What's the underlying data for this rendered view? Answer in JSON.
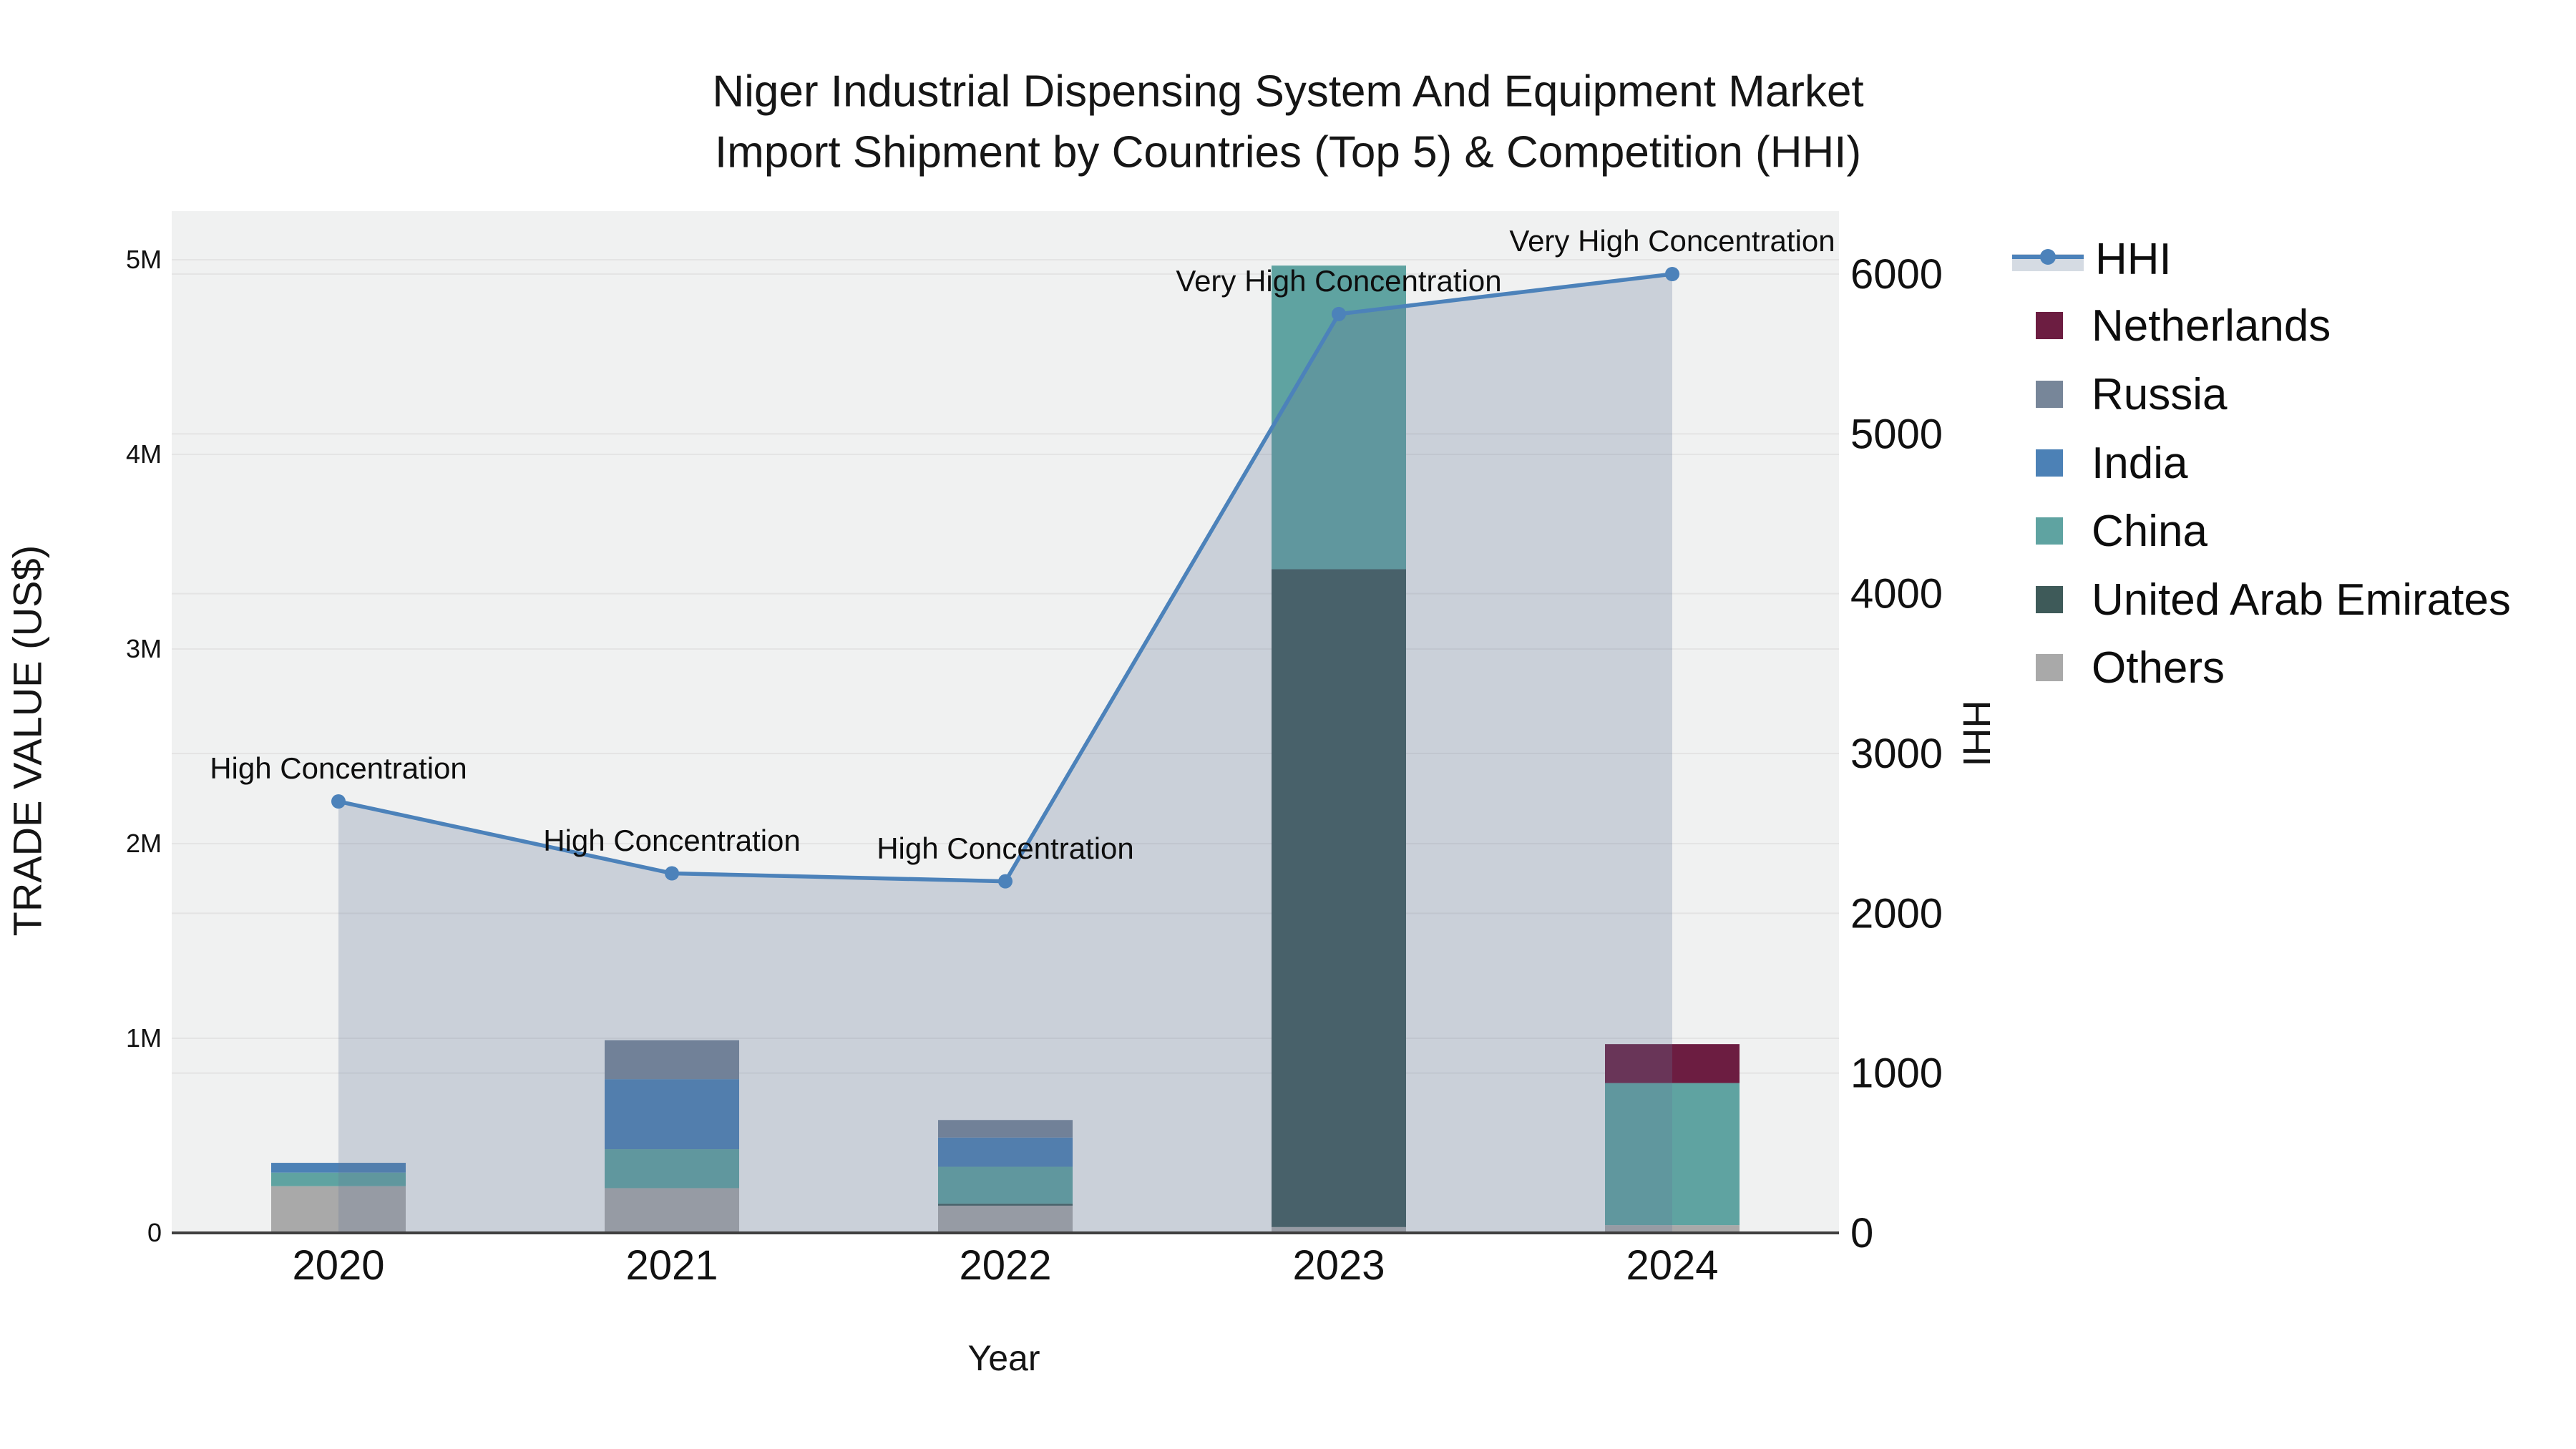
{
  "title": {
    "line1": "Niger Industrial Dispensing System And Equipment Market",
    "line2": "Import Shipment by Countries (Top 5) & Competition (HHI)"
  },
  "axes": {
    "x": {
      "title": "Year",
      "tick_labels": [
        "2020",
        "2021",
        "2022",
        "2023",
        "2024"
      ]
    },
    "y_left": {
      "title": "TRADE VALUE (US$)",
      "tick_labels": [
        "0",
        "1M",
        "2M",
        "3M",
        "4M",
        "5M"
      ],
      "tick_values": [
        0,
        1000000,
        2000000,
        3000000,
        4000000,
        5000000
      ]
    },
    "y_right": {
      "title": "HHI",
      "tick_labels": [
        "0",
        "1000",
        "2000",
        "3000",
        "4000",
        "5000",
        "6000"
      ],
      "tick_values": [
        0,
        1000,
        2000,
        3000,
        4000,
        5000,
        6000
      ]
    }
  },
  "legend": {
    "items": [
      {
        "label": "HHI",
        "type": "line",
        "color": "#4C82BA",
        "band": "#D5DBE3"
      },
      {
        "label": "Netherlands",
        "type": "swatch",
        "color": "#6C1D41"
      },
      {
        "label": "Russia",
        "type": "swatch",
        "color": "#778699"
      },
      {
        "label": "India",
        "type": "swatch",
        "color": "#4C81B6"
      },
      {
        "label": "China",
        "type": "swatch",
        "color": "#5FA3A1"
      },
      {
        "label": "United Arab Emirates",
        "type": "swatch",
        "color": "#3E5A59"
      },
      {
        "label": "Others",
        "type": "swatch",
        "color": "#A9A9A9"
      }
    ]
  },
  "chart_data": {
    "type": "bar+line",
    "categories": [
      "2020",
      "2021",
      "2022",
      "2023",
      "2024"
    ],
    "bar_value_unit": "US$",
    "stack_order_bottom_to_top": [
      "Others",
      "United Arab Emirates",
      "China",
      "India",
      "Russia",
      "Netherlands"
    ],
    "series": [
      {
        "name": "Netherlands",
        "type": "bar",
        "color": "#6C1D41",
        "values": [
          0,
          0,
          0,
          0,
          200000
        ]
      },
      {
        "name": "Russia",
        "type": "bar",
        "color": "#778699",
        "values": [
          0,
          200000,
          90000,
          0,
          0
        ]
      },
      {
        "name": "India",
        "type": "bar",
        "color": "#4C81B6",
        "values": [
          50000,
          360000,
          150000,
          0,
          0
        ]
      },
      {
        "name": "China",
        "type": "bar",
        "color": "#5FA3A1",
        "values": [
          70000,
          200000,
          190000,
          1560000,
          730000
        ]
      },
      {
        "name": "United Arab Emirates",
        "type": "bar",
        "color": "#3E5A59",
        "values": [
          0,
          0,
          10000,
          3380000,
          0
        ]
      },
      {
        "name": "Others",
        "type": "bar",
        "color": "#A9A9A9",
        "values": [
          240000,
          230000,
          140000,
          30000,
          40000
        ]
      }
    ],
    "line_series": {
      "name": "HHI",
      "axis": "right",
      "color": "#4C82BA",
      "area_fill": "rgba(100,120,150,0.27)",
      "values": [
        2700,
        2250,
        2200,
        5750,
        6000
      ],
      "point_annotations": [
        "High Concentration",
        "High Concentration",
        "High Concentration",
        "Very High Concentration",
        "Very High Concentration"
      ]
    },
    "ylim_left": [
      0,
      5000000
    ],
    "ylim_right": [
      0,
      6000
    ],
    "grid": true,
    "legend_position": "right",
    "title": "Niger Industrial Dispensing System And Equipment Market Import Shipment by Countries (Top 5) & Competition (HHI)",
    "xlabel": "Year",
    "ylabel_left": "TRADE VALUE (US$)",
    "ylabel_right": "HHI"
  },
  "colors": {
    "plot_bg": "#F0F1F1",
    "gridline": "#E4E4E4",
    "axis_line": "#3F3F3F",
    "text": "#111111"
  }
}
